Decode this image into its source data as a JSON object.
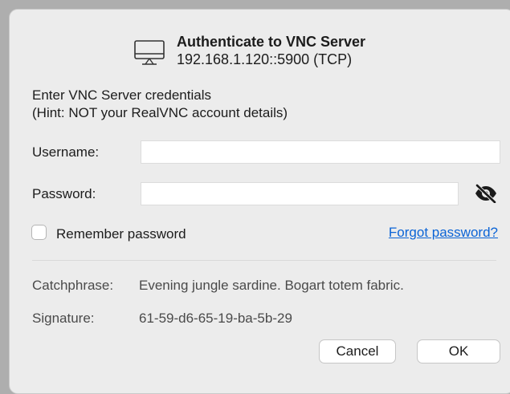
{
  "dialog": {
    "title": "Authenticate to VNC Server",
    "address": "192.168.1.120::5900 (TCP)",
    "icon": "monitor-icon"
  },
  "intro": {
    "line1": "Enter VNC Server credentials",
    "line2": "(Hint: NOT your RealVNC account details)"
  },
  "form": {
    "username_label": "Username:",
    "username_value": "",
    "password_label": "Password:",
    "password_value": "",
    "password_toggle_icon": "eye-slash-icon",
    "remember_label": "Remember password",
    "remember_checked": false,
    "forgot_link": "Forgot password?"
  },
  "info": {
    "catchphrase_label": "Catchphrase:",
    "catchphrase_value": "Evening jungle sardine. Bogart totem fabric.",
    "signature_label": "Signature:",
    "signature_value": "61-59-d6-65-19-ba-5b-29"
  },
  "buttons": {
    "cancel": "Cancel",
    "ok": "OK"
  },
  "colors": {
    "link": "#0b64d6",
    "background": "#ececec"
  }
}
